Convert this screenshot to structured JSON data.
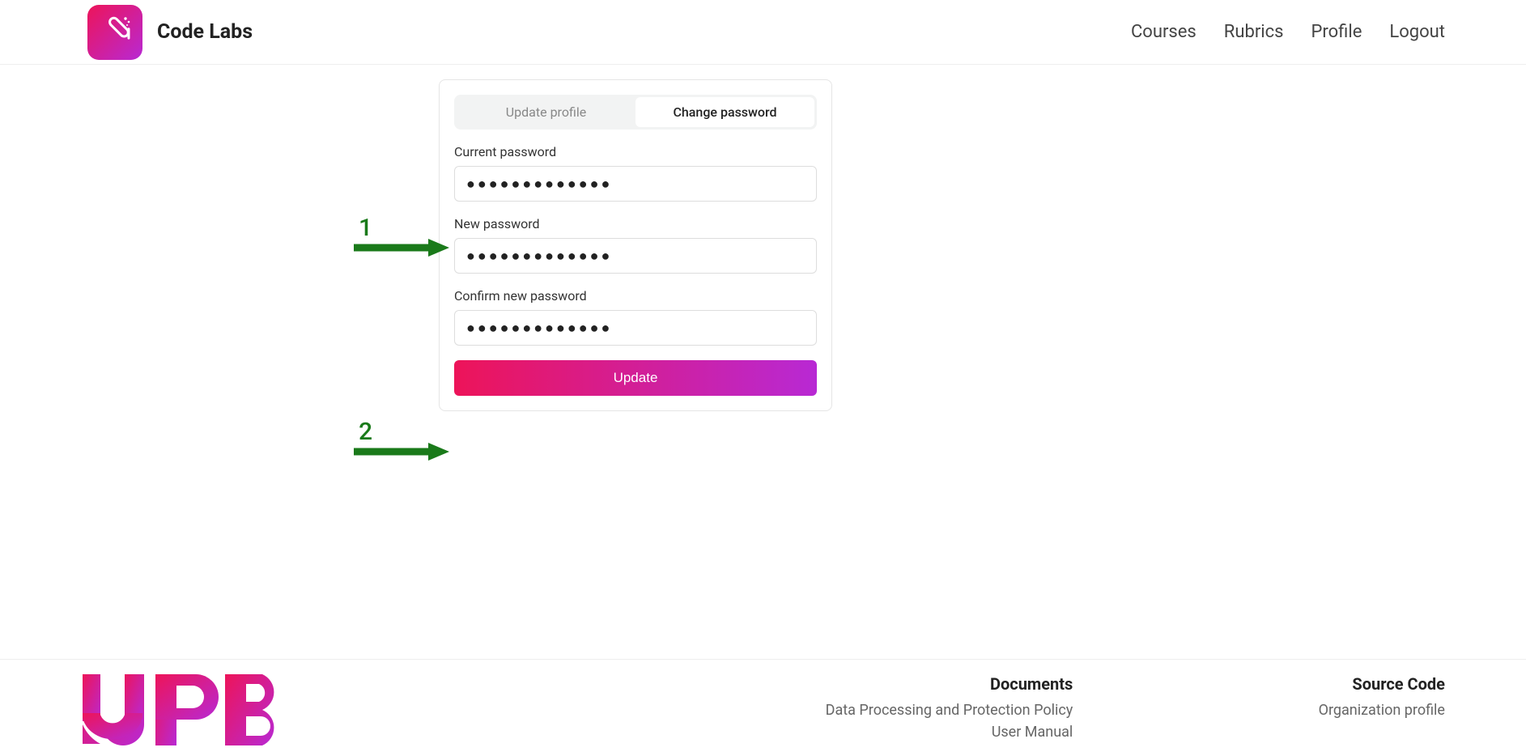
{
  "header": {
    "brand": "Code Labs",
    "nav": {
      "courses": "Courses",
      "rubrics": "Rubrics",
      "profile": "Profile",
      "logout": "Logout"
    }
  },
  "card": {
    "tabs": {
      "update_profile": "Update profile",
      "change_password": "Change password"
    },
    "fields": {
      "current_label": "Current password",
      "current_value": "●●●●●●●●●●●●●",
      "new_label": "New password",
      "new_value": "●●●●●●●●●●●●●",
      "confirm_label": "Confirm new password",
      "confirm_value": "●●●●●●●●●●●●●"
    },
    "button": "Update"
  },
  "annotations": {
    "one": "1",
    "two": "2"
  },
  "footer": {
    "documents": {
      "title": "Documents",
      "policy": "Data Processing and Protection Policy",
      "manual": "User Manual"
    },
    "source": {
      "title": "Source Code",
      "org": "Organization profile"
    }
  }
}
